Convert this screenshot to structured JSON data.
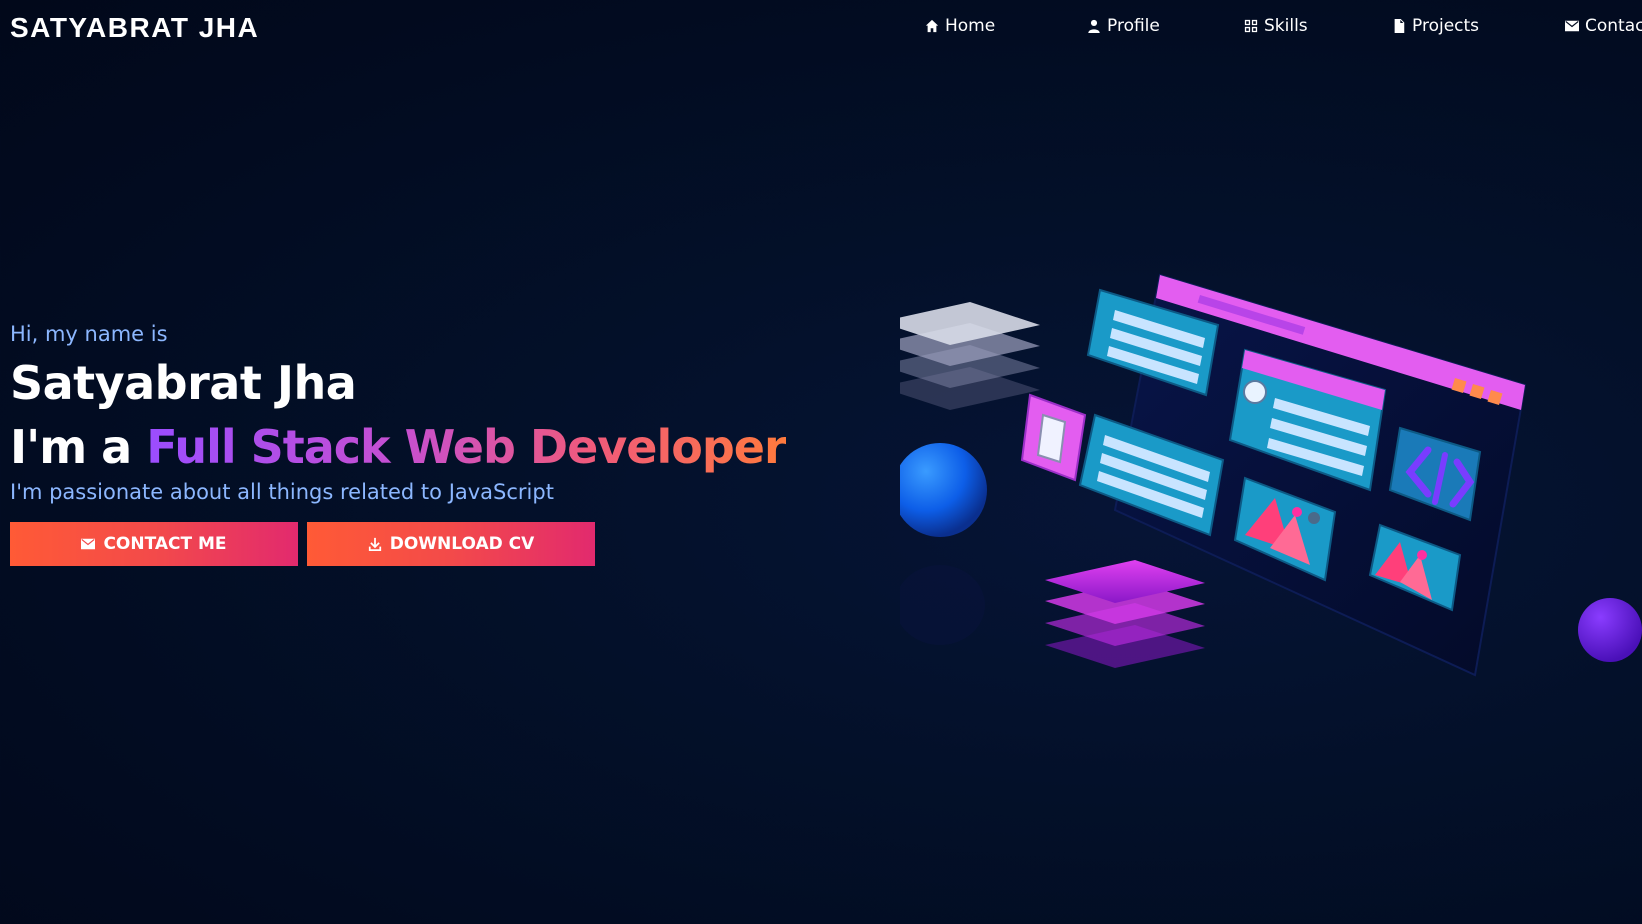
{
  "brand": "SATYABRAT JHA",
  "nav": [
    {
      "label": "Home",
      "icon": "home-icon"
    },
    {
      "label": "Profile",
      "icon": "user-icon"
    },
    {
      "label": "Skills",
      "icon": "grid-icon"
    },
    {
      "label": "Projects",
      "icon": "file-icon"
    },
    {
      "label": "Contact",
      "icon": "envelope-icon"
    }
  ],
  "hero": {
    "greeting": "Hi, my name is",
    "name": "Satyabrat Jha",
    "role_prefix": "I'm a ",
    "role_highlight": "Full Stack Web Developer",
    "tagline": "I'm passionate about all things related to JavaScript",
    "contact_button": "CONTACT ME",
    "download_button": "DOWNLOAD CV"
  },
  "colors": {
    "background": "#020b20",
    "accent_text": "#8cb7ff",
    "button_start": "#ff5a36",
    "button_end": "#e22a6e"
  }
}
